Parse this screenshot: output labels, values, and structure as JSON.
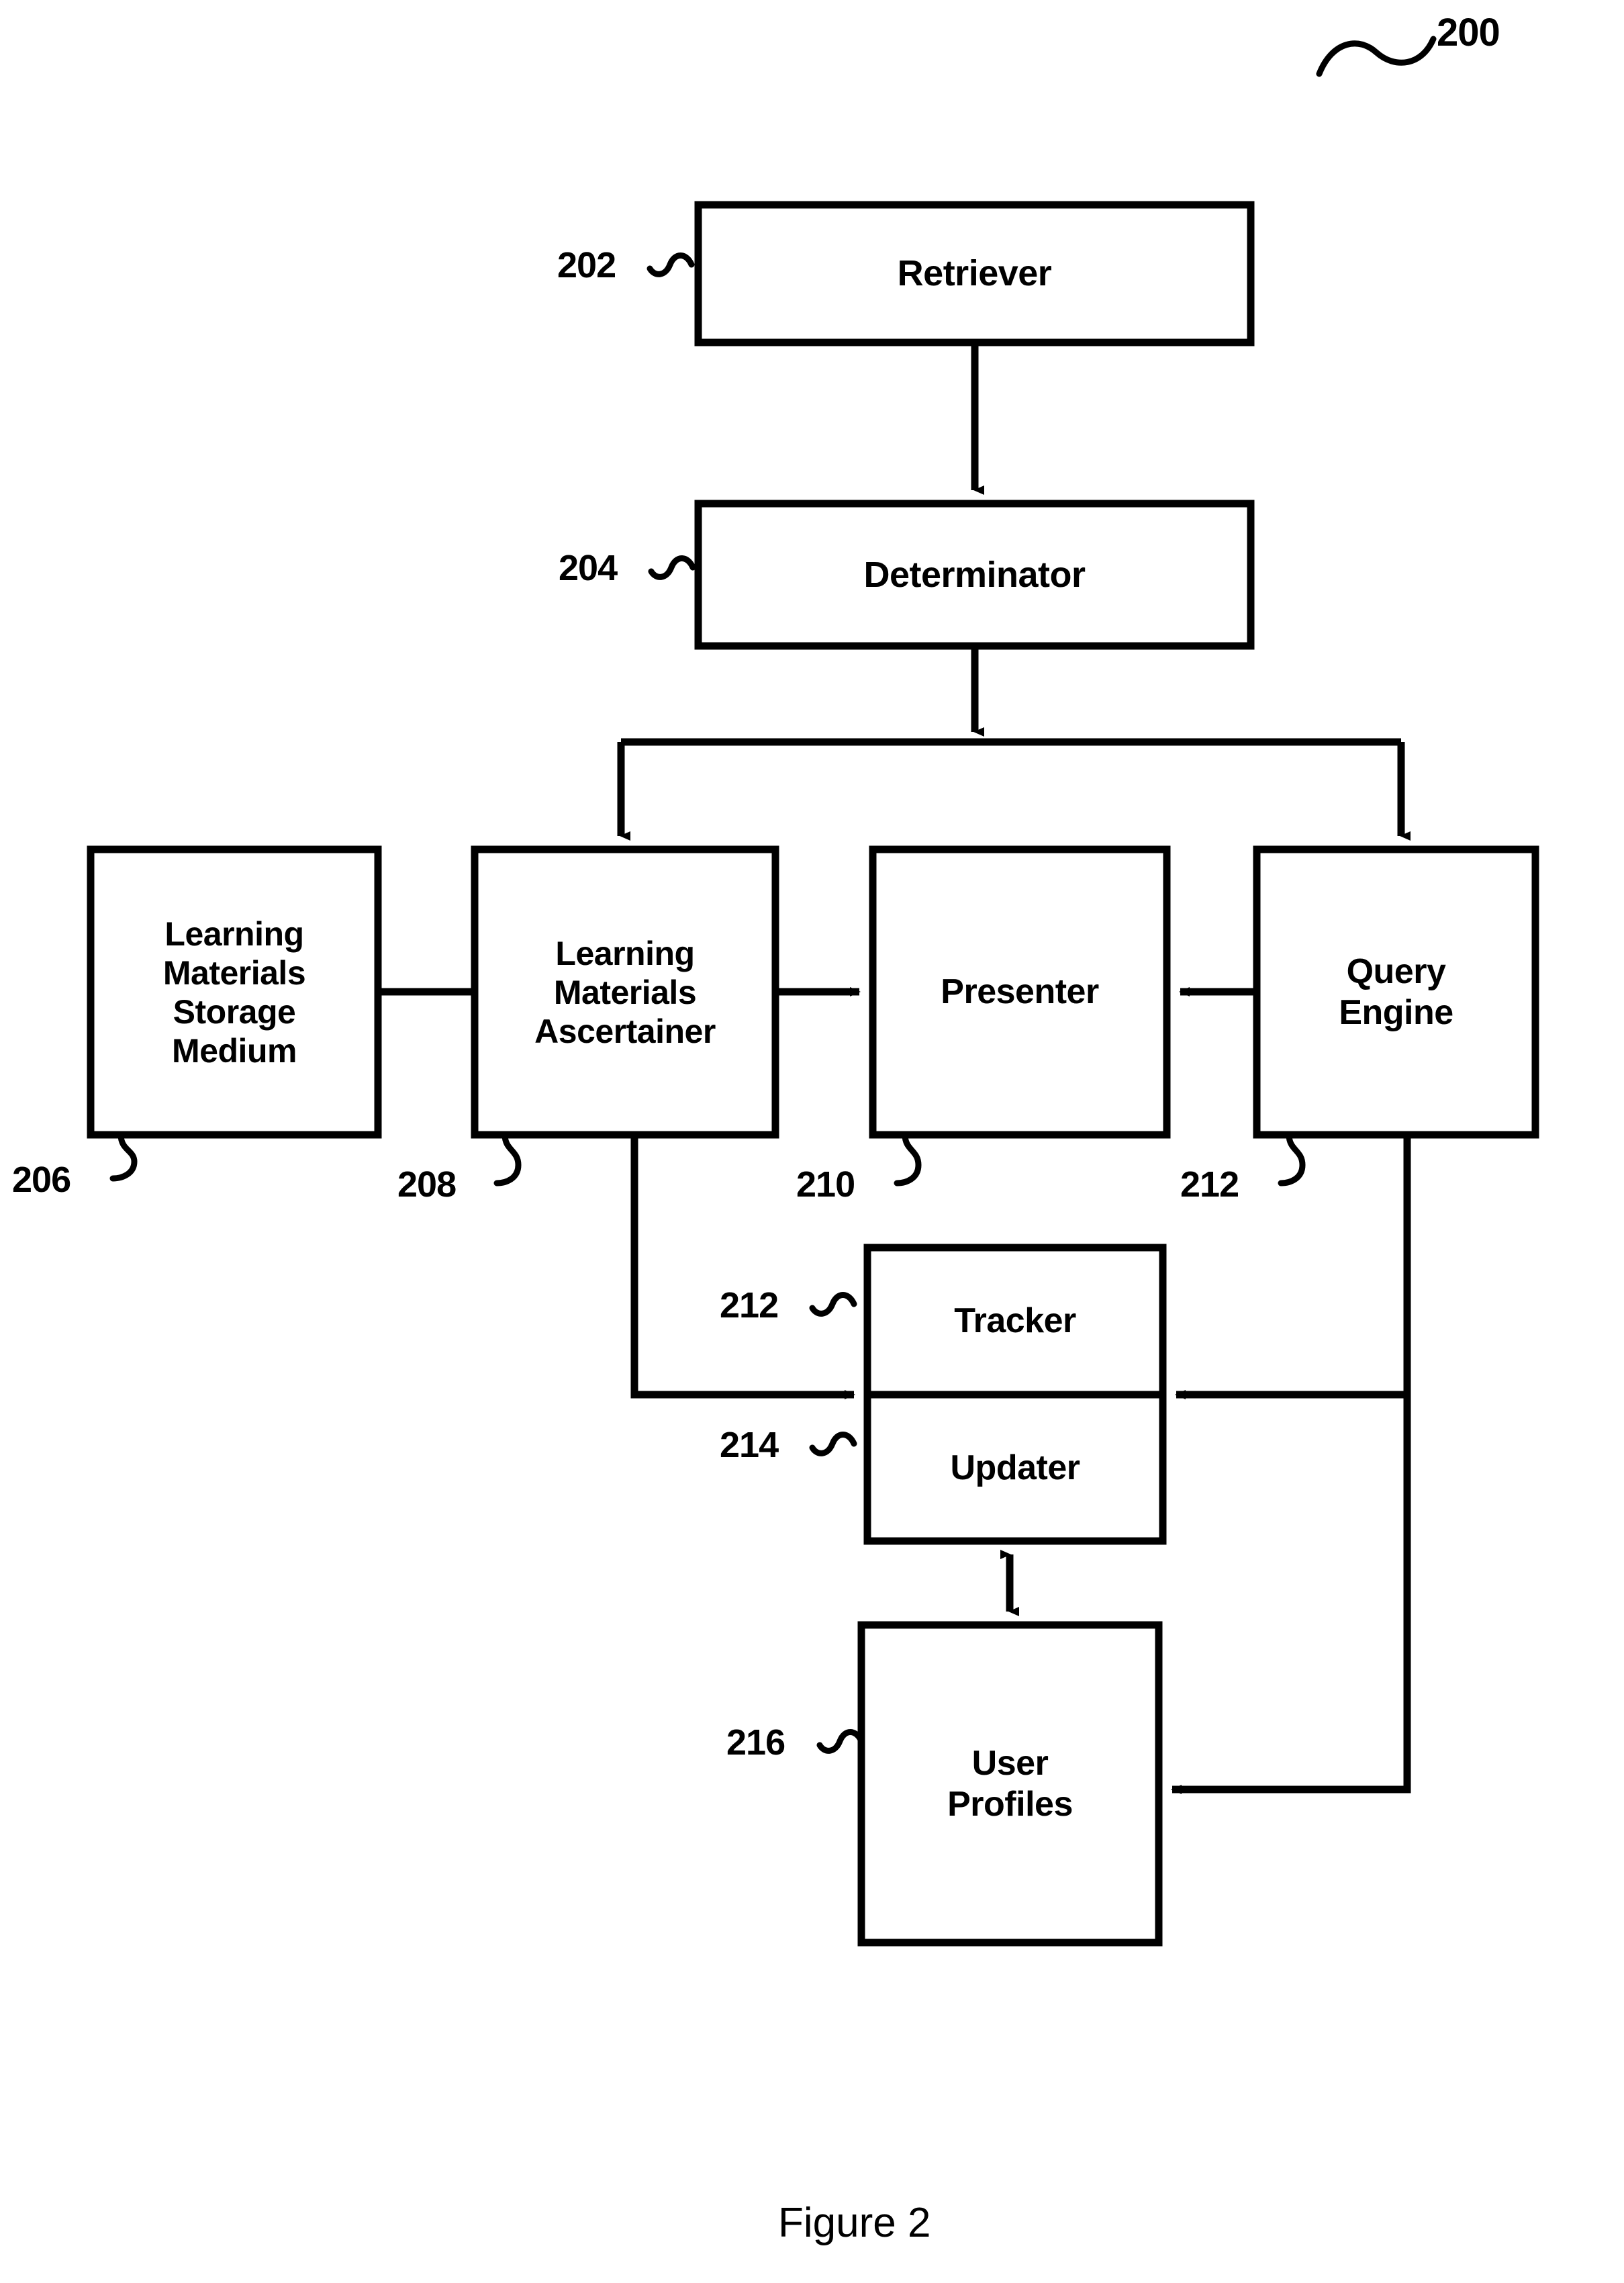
{
  "figure": {
    "caption": "Figure 2",
    "system_ref": "200"
  },
  "blocks": [
    {
      "id": "retriever",
      "label": "Retriever",
      "ref": "202",
      "lines": [
        "Retriever"
      ]
    },
    {
      "id": "determinator",
      "label": "Determinator",
      "ref": "204",
      "lines": [
        "Determinator"
      ]
    },
    {
      "id": "storage",
      "label": "Learning Materials Storage Medium",
      "ref": "206",
      "lines": [
        "Learning",
        "Materials",
        "Storage",
        "Medium"
      ]
    },
    {
      "id": "ascertainer",
      "label": "Learning Materials Ascertainer",
      "ref": "208",
      "lines": [
        "Learning",
        "Materials",
        "Ascertainer"
      ]
    },
    {
      "id": "presenter",
      "label": "Presenter",
      "ref": "210",
      "lines": [
        "Presenter"
      ]
    },
    {
      "id": "query_engine",
      "label": "Query Engine",
      "ref": "212",
      "lines": [
        "Query",
        "Engine"
      ]
    },
    {
      "id": "tracker",
      "label": "Tracker",
      "ref": "212",
      "lines": [
        "Tracker"
      ]
    },
    {
      "id": "updater",
      "label": "Updater",
      "ref": "214",
      "lines": [
        "Updater"
      ]
    },
    {
      "id": "user_profiles",
      "label": "User Profiles",
      "ref": "216",
      "lines": [
        "User",
        "Profiles"
      ]
    }
  ],
  "text": {
    "retriever": "Retriever",
    "determinator": "Determinator",
    "storage_l1": "Learning",
    "storage_l2": "Materials",
    "storage_l3": "Storage",
    "storage_l4": "Medium",
    "ascertainer_l1": "Learning",
    "ascertainer_l2": "Materials",
    "ascertainer_l3": "Ascertainer",
    "presenter": "Presenter",
    "query_l1": "Query",
    "query_l2": "Engine",
    "tracker": "Tracker",
    "updater": "Updater",
    "profiles_l1": "User",
    "profiles_l2": "Profiles"
  },
  "refs": {
    "system": "200",
    "retriever": "202",
    "determinator": "204",
    "storage": "206",
    "ascertainer": "208",
    "presenter": "210",
    "query_engine": "212",
    "tracker": "212",
    "updater": "214",
    "user_profiles": "216"
  },
  "colors": {
    "stroke": "#000000",
    "fill": "#ffffff",
    "background": "#ffffff"
  },
  "connections": [
    {
      "from": "retriever",
      "to": "determinator",
      "type": "arrow-down"
    },
    {
      "from": "determinator",
      "to": "ascertainer",
      "type": "arrow-down-branch"
    },
    {
      "from": "determinator",
      "to": "query_engine",
      "type": "arrow-down-branch"
    },
    {
      "from": "storage",
      "to": "ascertainer",
      "type": "line"
    },
    {
      "from": "ascertainer",
      "to": "presenter",
      "type": "arrow-right"
    },
    {
      "from": "query_engine",
      "to": "presenter",
      "type": "arrow-left"
    },
    {
      "from": "ascertainer",
      "to": "tracker",
      "type": "arrow-right-elbow"
    },
    {
      "from": "query_engine",
      "to": "tracker",
      "type": "arrow-left-elbow"
    },
    {
      "from": "updater",
      "to": "user_profiles",
      "type": "double-arrow-vertical"
    },
    {
      "from": "query_engine",
      "to": "user_profiles",
      "type": "arrow-left-elbow"
    }
  ]
}
